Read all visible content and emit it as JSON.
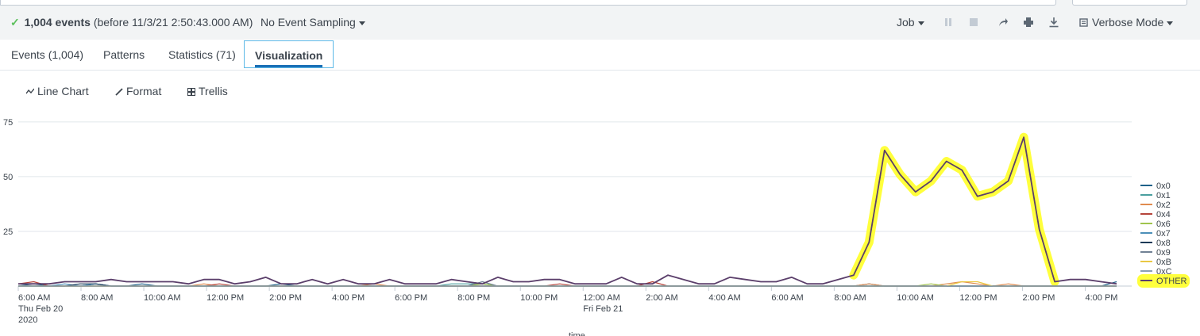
{
  "header": {
    "event_count": "1,004 events",
    "event_time": "(before 11/3/21 2:50:43.000 AM)",
    "sampling": "No Event Sampling",
    "job": "Job",
    "mode": "Verbose Mode"
  },
  "tabs": [
    {
      "label": "Events (1,004)"
    },
    {
      "label": "Patterns"
    },
    {
      "label": "Statistics (71)"
    },
    {
      "label": "Visualization"
    }
  ],
  "toolbar": {
    "line_chart": "Line Chart",
    "format": "Format",
    "trellis": "Trellis"
  },
  "chart_data": {
    "type": "line",
    "title": "",
    "xlabel": "time",
    "ylabel": "",
    "ylim": [
      0,
      80
    ],
    "yticks": [
      25,
      50,
      75
    ],
    "grid": true,
    "legend_position": "right",
    "x_start": "2020-02-20T06:00",
    "x_end": "2020-02-21T17:00",
    "x_step": "30 min",
    "xticks": [
      {
        "at": "2020-02-20T06:00",
        "label": "6:00 AM",
        "sub1": "Thu Feb 20",
        "sub2": "2020"
      },
      {
        "at": "2020-02-20T08:00",
        "label": "8:00 AM"
      },
      {
        "at": "2020-02-20T10:00",
        "label": "10:00 AM"
      },
      {
        "at": "2020-02-20T12:00",
        "label": "12:00 PM"
      },
      {
        "at": "2020-02-20T14:00",
        "label": "2:00 PM"
      },
      {
        "at": "2020-02-20T16:00",
        "label": "4:00 PM"
      },
      {
        "at": "2020-02-20T18:00",
        "label": "6:00 PM"
      },
      {
        "at": "2020-02-20T20:00",
        "label": "8:00 PM"
      },
      {
        "at": "2020-02-20T22:00",
        "label": "10:00 PM"
      },
      {
        "at": "2020-02-21T00:00",
        "label": "12:00 AM",
        "sub1": "Fri Feb 21"
      },
      {
        "at": "2020-02-21T02:00",
        "label": "2:00 AM"
      },
      {
        "at": "2020-02-21T04:00",
        "label": "4:00 AM"
      },
      {
        "at": "2020-02-21T06:00",
        "label": "6:00 AM"
      },
      {
        "at": "2020-02-21T08:00",
        "label": "8:00 AM"
      },
      {
        "at": "2020-02-21T10:00",
        "label": "10:00 AM"
      },
      {
        "at": "2020-02-21T12:00",
        "label": "12:00 PM"
      },
      {
        "at": "2020-02-21T14:00",
        "label": "2:00 PM"
      },
      {
        "at": "2020-02-21T16:00",
        "label": "4:00 PM"
      }
    ],
    "series": [
      {
        "name": "0x0",
        "color": "#1e6189",
        "values": [
          0,
          1,
          0,
          0,
          0,
          1,
          0,
          0,
          1,
          0,
          0,
          0,
          0,
          0,
          0,
          0,
          0,
          1,
          0,
          0,
          0,
          0,
          0,
          0,
          0,
          0,
          0,
          0,
          0,
          0,
          0,
          0,
          0,
          0,
          0,
          0,
          0,
          0,
          0,
          0,
          0,
          0,
          0,
          0,
          0,
          0,
          0,
          0,
          0,
          0,
          0,
          0,
          0,
          0,
          0,
          1,
          0,
          0,
          0,
          0,
          0,
          0,
          0,
          0,
          0,
          0,
          0,
          0,
          0,
          0,
          0,
          2
        ]
      },
      {
        "name": "0x1",
        "color": "#4a9f9f",
        "values": [
          0,
          0,
          0,
          0,
          0,
          0,
          0,
          0,
          0,
          0,
          0,
          0,
          0,
          0,
          0,
          0,
          0,
          0,
          0,
          0,
          0,
          0,
          0,
          0,
          0,
          0,
          0,
          0,
          1,
          1,
          1,
          0,
          0,
          0,
          0,
          0,
          0,
          0,
          0,
          0,
          0,
          0,
          0,
          0,
          0,
          0,
          0,
          0,
          0,
          0,
          0,
          0,
          0,
          0,
          0,
          0,
          0,
          0,
          0,
          0,
          0,
          0,
          0,
          0,
          0,
          0,
          0,
          0,
          0,
          0,
          0,
          0
        ]
      },
      {
        "name": "0x2",
        "color": "#e08b4f",
        "values": [
          0,
          0,
          0,
          0,
          0,
          0,
          0,
          0,
          0,
          0,
          0,
          0,
          1,
          0,
          0,
          0,
          0,
          0,
          0,
          0,
          0,
          0,
          0,
          1,
          0,
          0,
          0,
          0,
          0,
          0,
          0,
          0,
          0,
          0,
          0,
          0,
          0,
          0,
          0,
          0,
          0,
          0,
          0,
          0,
          0,
          0,
          0,
          0,
          0,
          0,
          0,
          0,
          0,
          0,
          0,
          1,
          0,
          0,
          0,
          0,
          1,
          2,
          1,
          0,
          1,
          0,
          0,
          0,
          0,
          0,
          0,
          0
        ]
      },
      {
        "name": "0x4",
        "color": "#b5443b",
        "values": [
          1,
          2,
          0,
          0,
          0,
          0,
          0,
          0,
          0,
          0,
          0,
          0,
          0,
          1,
          0,
          0,
          0,
          0,
          0,
          0,
          0,
          0,
          0,
          0,
          0,
          0,
          0,
          0,
          0,
          0,
          0,
          0,
          0,
          0,
          0,
          1,
          0,
          0,
          0,
          0,
          0,
          2,
          0,
          0,
          0,
          0,
          0,
          0,
          0,
          0,
          0,
          0,
          0,
          0,
          0,
          0,
          0,
          0,
          0,
          0,
          0,
          0,
          0,
          0,
          0,
          0,
          0,
          0,
          0,
          0,
          0,
          0
        ]
      },
      {
        "name": "0x6",
        "color": "#a0c44c",
        "values": [
          0,
          0,
          0,
          0,
          0,
          0,
          0,
          0,
          0,
          0,
          0,
          0,
          0,
          0,
          0,
          0,
          0,
          0,
          0,
          0,
          0,
          0,
          0,
          0,
          0,
          0,
          0,
          0,
          0,
          0,
          1,
          0,
          0,
          0,
          0,
          0,
          0,
          0,
          0,
          0,
          0,
          0,
          0,
          0,
          0,
          0,
          0,
          0,
          0,
          0,
          0,
          0,
          0,
          0,
          0,
          0,
          0,
          0,
          0,
          1,
          0,
          0,
          0,
          0,
          0,
          0,
          0,
          0,
          0,
          0,
          0,
          0
        ]
      },
      {
        "name": "0x7",
        "color": "#4b8fb8",
        "values": [
          0,
          0,
          0,
          1,
          0,
          1,
          0,
          0,
          0,
          0,
          0,
          0,
          0,
          0,
          0,
          0,
          0,
          0,
          0,
          0,
          0,
          0,
          0,
          0,
          0,
          0,
          0,
          0,
          0,
          0,
          0,
          0,
          0,
          0,
          0,
          0,
          0,
          0,
          0,
          0,
          0,
          0,
          0,
          0,
          0,
          0,
          0,
          0,
          0,
          0,
          0,
          0,
          0,
          0,
          0,
          0,
          0,
          0,
          0,
          0,
          0,
          0,
          0,
          0,
          0,
          0,
          0,
          0,
          0,
          0,
          0,
          0
        ]
      },
      {
        "name": "0x8",
        "color": "#1b3a57",
        "values": [
          0,
          0,
          0,
          0,
          1,
          1,
          0,
          0,
          0,
          0,
          0,
          0,
          0,
          0,
          0,
          0,
          0,
          0,
          0,
          0,
          0,
          0,
          0,
          0,
          0,
          0,
          0,
          0,
          0,
          0,
          0,
          0,
          0,
          0,
          0,
          0,
          0,
          0,
          0,
          0,
          0,
          0,
          0,
          0,
          0,
          0,
          0,
          0,
          0,
          0,
          0,
          0,
          0,
          0,
          0,
          0,
          0,
          0,
          0,
          0,
          0,
          0,
          0,
          0,
          0,
          0,
          0,
          0,
          0,
          0,
          0,
          0
        ]
      },
      {
        "name": "0x9",
        "color": "#708194",
        "values": [
          0,
          0,
          0,
          0,
          0,
          0,
          0,
          0,
          0,
          0,
          0,
          0,
          0,
          0,
          0,
          0,
          0,
          0,
          0,
          0,
          0,
          0,
          0,
          0,
          0,
          0,
          0,
          0,
          0,
          0,
          2,
          0,
          0,
          0,
          0,
          0,
          0,
          0,
          0,
          0,
          0,
          0,
          0,
          0,
          0,
          0,
          0,
          0,
          0,
          0,
          0,
          0,
          0,
          0,
          0,
          0,
          0,
          0,
          0,
          0,
          0,
          0,
          0,
          0,
          0,
          0,
          0,
          0,
          0,
          0,
          0,
          0
        ]
      },
      {
        "name": "0xB",
        "color": "#eac843",
        "values": [
          0,
          0,
          0,
          0,
          0,
          0,
          0,
          0,
          0,
          0,
          0,
          0,
          0,
          0,
          0,
          0,
          0,
          0,
          0,
          0,
          0,
          0,
          0,
          0,
          0,
          0,
          0,
          0,
          0,
          0,
          0,
          0,
          0,
          0,
          0,
          0,
          0,
          0,
          0,
          0,
          0,
          0,
          0,
          0,
          0,
          0,
          0,
          0,
          0,
          0,
          0,
          0,
          0,
          0,
          0,
          0,
          0,
          0,
          0,
          0,
          0,
          2,
          2,
          0,
          0,
          0,
          0,
          0,
          0,
          0,
          0,
          0
        ]
      },
      {
        "name": "0xC",
        "color": "#8a9eb3",
        "values": [
          0,
          0,
          0,
          0,
          0,
          0,
          0,
          0,
          0,
          0,
          0,
          0,
          0,
          0,
          0,
          0,
          0,
          0,
          0,
          0,
          0,
          0,
          0,
          0,
          0,
          0,
          0,
          0,
          0,
          0,
          0,
          0,
          0,
          0,
          0,
          0,
          0,
          0,
          0,
          0,
          0,
          0,
          0,
          0,
          0,
          0,
          0,
          0,
          0,
          0,
          0,
          0,
          0,
          0,
          0,
          0,
          0,
          0,
          0,
          0,
          0,
          0,
          0,
          0,
          0,
          0,
          0,
          0,
          0,
          0,
          0,
          0
        ]
      },
      {
        "name": "OTHER",
        "color": "#5b3f6b",
        "values": [
          1,
          1,
          1,
          2,
          2,
          2,
          3,
          2,
          2,
          2,
          2,
          1,
          3,
          3,
          1,
          2,
          4,
          1,
          1,
          3,
          1,
          3,
          1,
          1,
          3,
          1,
          1,
          1,
          3,
          2,
          1,
          4,
          2,
          2,
          3,
          3,
          1,
          1,
          1,
          4,
          1,
          1,
          5,
          3,
          1,
          1,
          4,
          3,
          2,
          2,
          4,
          1,
          1,
          3,
          5,
          20,
          62,
          51,
          43,
          48,
          57,
          53,
          41,
          43,
          48,
          68,
          26,
          2,
          3,
          3,
          2,
          1
        ]
      }
    ]
  },
  "legend_highlight_color": "#ffff3c",
  "annotation_color": "#ffff3c"
}
